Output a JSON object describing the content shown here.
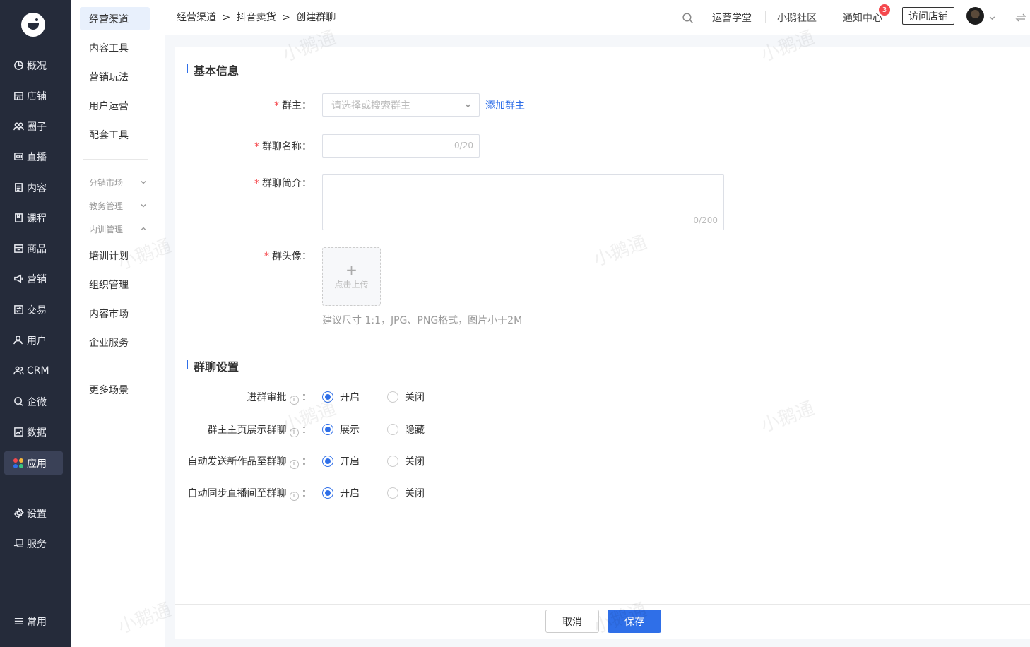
{
  "nav_primary": {
    "items": [
      {
        "label": "概况",
        "icon": "pie-chart-icon"
      },
      {
        "label": "店铺",
        "icon": "store-icon"
      },
      {
        "label": "圈子",
        "icon": "group-icon"
      },
      {
        "label": "直播",
        "icon": "live-icon"
      },
      {
        "label": "内容",
        "icon": "document-icon"
      },
      {
        "label": "课程",
        "icon": "book-icon"
      },
      {
        "label": "商品",
        "icon": "box-icon"
      },
      {
        "label": "营销",
        "icon": "megaphone-icon"
      },
      {
        "label": "交易",
        "icon": "exchange-icon"
      },
      {
        "label": "用户",
        "icon": "user-icon"
      },
      {
        "label": "CRM",
        "icon": "crm-icon"
      },
      {
        "label": "企微",
        "icon": "chat-icon"
      },
      {
        "label": "数据",
        "icon": "chart-icon"
      },
      {
        "label": "应用",
        "icon": "apps-icon",
        "active": true
      },
      {
        "label": "设置",
        "icon": "gear-icon"
      },
      {
        "label": "服务",
        "icon": "service-icon"
      },
      {
        "label": "常用",
        "icon": "list-icon"
      }
    ]
  },
  "nav_secondary": {
    "items": [
      "经营渠道",
      "内容工具",
      "营销玩法",
      "用户运营",
      "配套工具"
    ],
    "groups": [
      "分销市场",
      "教务管理",
      "内训管理"
    ],
    "sub_items": [
      "培训计划",
      "组织管理",
      "内容市场",
      "企业服务"
    ],
    "more": "更多场景"
  },
  "header": {
    "breadcrumb": [
      "经营渠道",
      ">",
      "抖音卖货",
      ">",
      "创建群聊"
    ],
    "links": [
      "运营学堂",
      "小鹅社区",
      "通知中心"
    ],
    "notification_count": "3",
    "visit_store": "访问店铺"
  },
  "form": {
    "section_basic": "基本信息",
    "owner_label": "群主：",
    "owner_placeholder": "请选择或搜索群主",
    "add_owner": "添加群主",
    "name_label": "群聊名称：",
    "name_counter": "0/20",
    "intro_label": "群聊简介：",
    "intro_counter": "0/200",
    "avatar_label": "群头像：",
    "upload_text": "点击上传",
    "upload_hint": "建议尺寸 1:1，JPG、PNG格式，图片小于2M",
    "required_mark": "*",
    "section_settings": "群聊设置",
    "settings": [
      {
        "label": "进群审批",
        "options": [
          "开启",
          "关闭"
        ],
        "selected": 0
      },
      {
        "label": "群主主页展示群聊",
        "options": [
          "展示",
          "隐藏"
        ],
        "selected": 0
      },
      {
        "label": "自动发送新作品至群聊",
        "options": [
          "开启",
          "关闭"
        ],
        "selected": 0
      },
      {
        "label": "自动同步直播间至群聊",
        "options": [
          "开启",
          "关闭"
        ],
        "selected": 0
      }
    ]
  },
  "footer": {
    "cancel": "取消",
    "save": "保存"
  },
  "watermark": "小鹅通",
  "colors": {
    "primary": "#2f6fe8",
    "sidebar": "#252b3a",
    "required": "#f5484d"
  }
}
